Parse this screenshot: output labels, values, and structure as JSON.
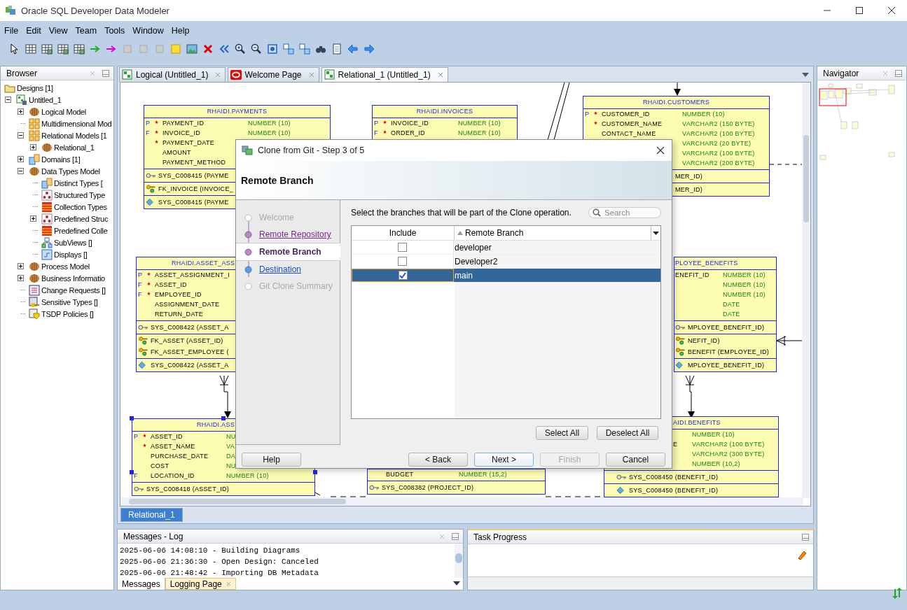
{
  "window": {
    "title": "Oracle SQL Developer Data Modeler"
  },
  "menu": [
    "File",
    "Edit",
    "View",
    "Team",
    "Tools",
    "Window",
    "Help"
  ],
  "browser": {
    "title": "Browser",
    "tree": [
      {
        "label": "Designs [1]",
        "kind": "folder",
        "children": [
          {
            "label": "Untitled_1",
            "kind": "design",
            "expanded": true,
            "children": [
              {
                "label": "Logical Model",
                "kind": "cube",
                "expanded": false
              },
              {
                "label": "Multidimensional Mod",
                "kind": "grid"
              },
              {
                "label": "Relational Models [1",
                "kind": "grid",
                "expanded": true,
                "children": [
                  {
                    "label": "Relational_1",
                    "kind": "cube",
                    "expanded": false
                  }
                ]
              },
              {
                "label": "Domains [1]",
                "kind": "domain",
                "expanded": false
              },
              {
                "label": "Data Types Model",
                "kind": "cube",
                "expanded": true,
                "children": [
                  {
                    "label": "Distinct Types [",
                    "kind": "domain"
                  },
                  {
                    "label": "Structured Type",
                    "kind": "structured"
                  },
                  {
                    "label": "Collection Types",
                    "kind": "collection"
                  },
                  {
                    "label": "Predefined Struc",
                    "kind": "structured",
                    "expanded": false
                  },
                  {
                    "label": "Predefined Colle",
                    "kind": "collection"
                  },
                  {
                    "label": "SubViews []",
                    "kind": "subviews"
                  },
                  {
                    "label": "Displays []",
                    "kind": "displays"
                  }
                ]
              },
              {
                "label": "Process Model",
                "kind": "cube",
                "expanded": false
              },
              {
                "label": "Business Informatio",
                "kind": "cube",
                "expanded": false
              },
              {
                "label": "Change Requests []",
                "kind": "list"
              },
              {
                "label": "Sensitive Types []",
                "kind": "sensitive"
              },
              {
                "label": "TSDP Policies []",
                "kind": "policy"
              }
            ]
          }
        ]
      }
    ]
  },
  "editor_tabs": [
    {
      "label": "Logical (Untitled_1)",
      "kind": "logical",
      "selected": false
    },
    {
      "label": "Welcome Page",
      "kind": "welcome",
      "selected": false
    },
    {
      "label": "Relational_1 (Untitled_1)",
      "kind": "relational",
      "selected": true
    }
  ],
  "diagram": {
    "tables": [
      {
        "title": "RHAIDI.PAYMENTS",
        "selected": false,
        "rows": [
          {
            "flag": "P",
            "required": true,
            "name": "PAYMENT_ID",
            "type": "NUMBER (10)"
          },
          {
            "flag": "F",
            "required": true,
            "name": "INVOICE_ID",
            "type": "NUMBER (10)"
          },
          {
            "required": true,
            "name": "PAYMENT_DATE"
          },
          {
            "required": false,
            "name": "AMOUNT"
          },
          {
            "required": false,
            "name": "PAYMENT_METHOD"
          }
        ],
        "keys": [
          {
            "kind": "pk",
            "text": "SYS_C008415 (PAYME"
          },
          {
            "kind": "fk",
            "text": "FK_INVOICE (INVOICE_"
          },
          {
            "kind": "index",
            "text": "SYS_C008415 (PAYME"
          }
        ]
      },
      {
        "title": "RHAIDI.INVOICES",
        "selected": false,
        "rows": [
          {
            "flag": "P",
            "required": true,
            "name": "INVOICE_ID",
            "type": "NUMBER (10)"
          },
          {
            "flag": "F",
            "required": true,
            "name": "ORDER_ID",
            "type": "NUMBER (10)"
          }
        ]
      },
      {
        "title": "RHAIDI.CUSTOMERS",
        "selected": false,
        "rows": [
          {
            "flag": "P",
            "required": true,
            "name": "CUSTOMER_ID",
            "type": "NUMBER (10)"
          },
          {
            "required": true,
            "name": "CUSTOMER_NAME",
            "type": "VARCHAR2 (150 BYTE)"
          },
          {
            "required": false,
            "name": "CONTACT_NAME",
            "type": "VARCHAR2 (100 BYTE)"
          },
          {
            "required": false,
            "type": "VARCHAR2 (20 BYTE)"
          },
          {
            "required": false,
            "type": "VARCHAR2 (100 BYTE)"
          },
          {
            "required": false,
            "type": "VARCHAR2 (200 BYTE)"
          }
        ],
        "keys": [
          {
            "kind": "pk",
            "text": "MER_ID)"
          },
          {
            "kind": "index",
            "text": "MER_ID)"
          }
        ]
      },
      {
        "title": "RHAIDI.ASSET_ASS",
        "selected": false,
        "rows": [
          {
            "flag": "P",
            "required": true,
            "name": "ASSET_ASSIGNMENT_I"
          },
          {
            "flag": "F",
            "required": true,
            "name": "ASSET_ID"
          },
          {
            "flag": "F",
            "required": true,
            "name": "EMPLOYEE_ID"
          },
          {
            "required": false,
            "name": "ASSIGNMENT_DATE"
          },
          {
            "required": false,
            "name": "RETURN_DATE"
          }
        ],
        "keys": [
          {
            "kind": "pk",
            "text": "SYS_C008422 (ASSET_A"
          },
          {
            "kind": "fk",
            "text": "FK_ASSET (ASSET_ID)"
          },
          {
            "kind": "fk",
            "text": "FK_ASSET_EMPLOYEE ("
          },
          {
            "kind": "index",
            "text": "SYS_C008422 (ASSET_A"
          }
        ]
      },
      {
        "title": "PLOYEE_BENEFITS",
        "selected": false,
        "rows": [
          {
            "required": false,
            "name": "ENEFIT_ID",
            "type": "NUMBER (10)"
          },
          {
            "required": false,
            "type": "NUMBER (10)"
          },
          {
            "required": false,
            "type": "NUMBER (10)"
          },
          {
            "required": false,
            "type": "DATE"
          },
          {
            "required": false,
            "type": "DATE"
          }
        ],
        "keys": [
          {
            "kind": "pk",
            "text": "MPLOYEE_BENEFIT_ID)"
          },
          {
            "kind": "fk",
            "text": "NEFIT_ID)"
          },
          {
            "kind": "fk",
            "text": "BENEFIT (EMPLOYEE_ID)"
          },
          {
            "kind": "index",
            "text": "MPLOYEE_BENEFIT_ID)"
          }
        ]
      },
      {
        "title": "RHAIDI.ASS",
        "selected": true,
        "rows": [
          {
            "flag": "P",
            "required": true,
            "name": "ASSET_ID",
            "type": "NU"
          },
          {
            "required": true,
            "name": "ASSET_NAME",
            "type": "VA"
          },
          {
            "required": false,
            "name": "PURCHASE_DATE",
            "type": "DA"
          },
          {
            "required": false,
            "name": "COST",
            "type": "NU"
          },
          {
            "flag": "F",
            "required": false,
            "name": "LOCATION_ID",
            "type": "NUMBER (10)"
          }
        ],
        "keys": [
          {
            "kind": "pk",
            "text": "SYS_C008418 (ASSET_ID)"
          }
        ]
      },
      {
        "selected": false,
        "rows": [
          {
            "required": false,
            "name": "BUDGET",
            "type": "NUMBER (15,2)"
          }
        ],
        "keys": [
          {
            "kind": "pk",
            "text": "SYS_C008382 (PROJECT_ID)"
          }
        ]
      },
      {
        "title": "AIDI.BENEFITS",
        "selected": false,
        "rows": [
          {
            "required": false,
            "type": "NUMBER (10)"
          },
          {
            "required": false,
            "name": "E",
            "type": "VARCHAR2 (100 BYTE)"
          },
          {
            "required": false,
            "type": "VARCHAR2 (300 BYTE)"
          },
          {
            "required": false,
            "type": "NUMBER (10,2)"
          }
        ],
        "keys": [
          {
            "kind": "pk",
            "text": "SYS_C008450 (BENEFIT_ID)"
          },
          {
            "kind": "index",
            "text": "SYS_C008450 (BENEFIT_ID)"
          }
        ]
      }
    ],
    "tabs": [
      {
        "label": "Relational_1",
        "selected": true
      }
    ]
  },
  "navigator": {
    "title": "Navigator"
  },
  "dialog": {
    "title": "Clone from Git - Step 3 of 5",
    "heading": "Remote Branch",
    "steps": [
      {
        "label": "Welcome",
        "selected": false,
        "visited": false,
        "disabled": true
      },
      {
        "label": "Remote Repository",
        "selected": false,
        "visited": true,
        "disabled": false
      },
      {
        "label": "Remote Branch",
        "selected": true,
        "visited": false,
        "disabled": false
      },
      {
        "label": "Destination",
        "selected": false,
        "visited": false,
        "disabled": false
      },
      {
        "label": "Git Clone Summary",
        "selected": false,
        "visited": false,
        "disabled": true
      }
    ],
    "instruction": "Select the branches that will be part of the Clone operation.",
    "search": {
      "placeholder": "Search"
    },
    "columns": [
      "Include",
      "Remote Branch"
    ],
    "branches": [
      {
        "name": "developer",
        "include": false,
        "selected": false
      },
      {
        "name": "Developer2",
        "include": false,
        "selected": false
      },
      {
        "name": "main",
        "include": true,
        "selected": true
      }
    ],
    "table_buttons": [
      "Select All",
      "Deselect All"
    ],
    "buttons": [
      {
        "label": "Help",
        "default": false,
        "disabled": false
      },
      {
        "label": "< Back",
        "default": false,
        "disabled": false
      },
      {
        "label": "Next >",
        "default": true,
        "disabled": false
      },
      {
        "label": "Finish",
        "default": false,
        "disabled": true
      },
      {
        "label": "Cancel",
        "default": false,
        "disabled": false
      }
    ]
  },
  "messages": {
    "title": "Messages - Log",
    "lines": [
      "2025-06-06 14:08:10 - Building Diagrams",
      "2025-06-06 21:36:30 - Open Design: Canceled",
      "2025-06-06 21:48:42 - Importing DB Metadata"
    ],
    "tabs": [
      {
        "label": "Messages",
        "selected": false
      },
      {
        "label": "Logging Page",
        "selected": true
      }
    ]
  },
  "task_progress": {
    "title": "Task Progress"
  }
}
